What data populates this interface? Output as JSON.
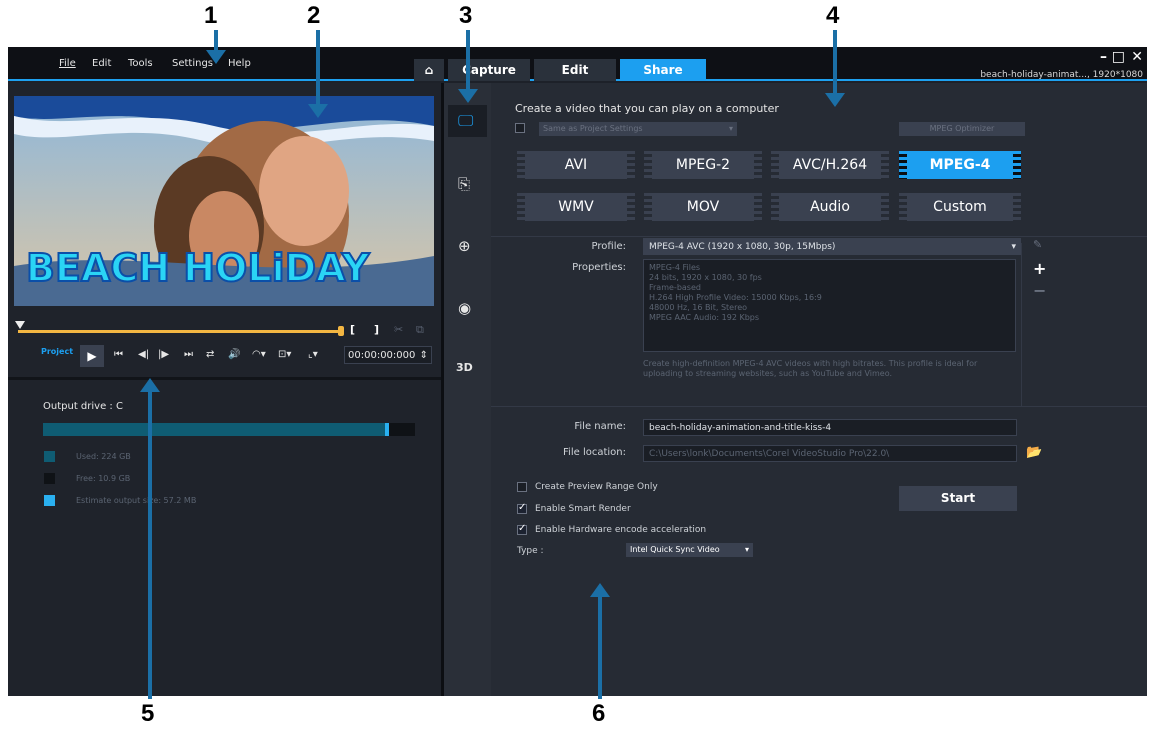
{
  "callouts": [
    "1",
    "2",
    "3",
    "4",
    "5",
    "6"
  ],
  "menu": {
    "file": "File",
    "edit": "Edit",
    "tools": "Tools",
    "settings": "Settings",
    "help": "Help"
  },
  "tabs": {
    "home_icon": "home-icon",
    "capture": "Capture",
    "edit": "Edit",
    "share": "Share"
  },
  "window": {
    "title": "beach-holiday-animat..., 1920*1080",
    "minimize": "–",
    "maximize": "□",
    "close": "✕"
  },
  "preview": {
    "overlay_title": "BEACH HOLiDAY",
    "project_label": "Project",
    "timecode": "00:00:00:000"
  },
  "drive": {
    "label": "Output drive : C",
    "used": "Used: 224 GB",
    "free": "Free: 10.9 GB",
    "estimate": "Estimate output size: 57.2 MB",
    "used_fraction": 0.93
  },
  "share": {
    "heading": "Create a video that you can play on a computer",
    "same_as_project": "Same as Project Settings",
    "optimizer": "MPEG Optimizer",
    "formats": [
      "AVI",
      "MPEG-2",
      "AVC/H.264",
      "MPEG-4",
      "WMV",
      "MOV",
      "Audio",
      "Custom"
    ],
    "selected_format": "MPEG-4",
    "profile_label": "Profile:",
    "profile_value": "MPEG-4 AVC (1920 x 1080, 30p, 15Mbps)",
    "properties_label": "Properties:",
    "properties": [
      "MPEG-4 Files",
      "24 bits, 1920 x 1080, 30 fps",
      "Frame-based",
      "H.264 High Profile Video: 15000 Kbps, 16:9",
      "48000 Hz, 16 Bit, Stereo",
      "MPEG AAC Audio: 192 Kbps"
    ],
    "description": "Create high-definition MPEG-4 AVC videos with high bitrates. This profile is ideal for uploading to streaming websites, such as YouTube and Vimeo.",
    "filename_label": "File name:",
    "filename_value": "beach-holiday-animation-and-title-kiss-4",
    "location_label": "File location:",
    "location_value": "C:\\Users\\lonk\\Documents\\Corel VideoStudio Pro\\22.0\\",
    "preview_range": "Create Preview Range Only",
    "smart_render": "Enable Smart Render",
    "hw_accel": "Enable Hardware encode acceleration",
    "type_label": "Type :",
    "type_value": "Intel Quick Sync Video",
    "start": "Start"
  },
  "colors": {
    "accent": "#1c9ff0",
    "bg": "#1d2129",
    "arrow": "#1b6fa6"
  }
}
